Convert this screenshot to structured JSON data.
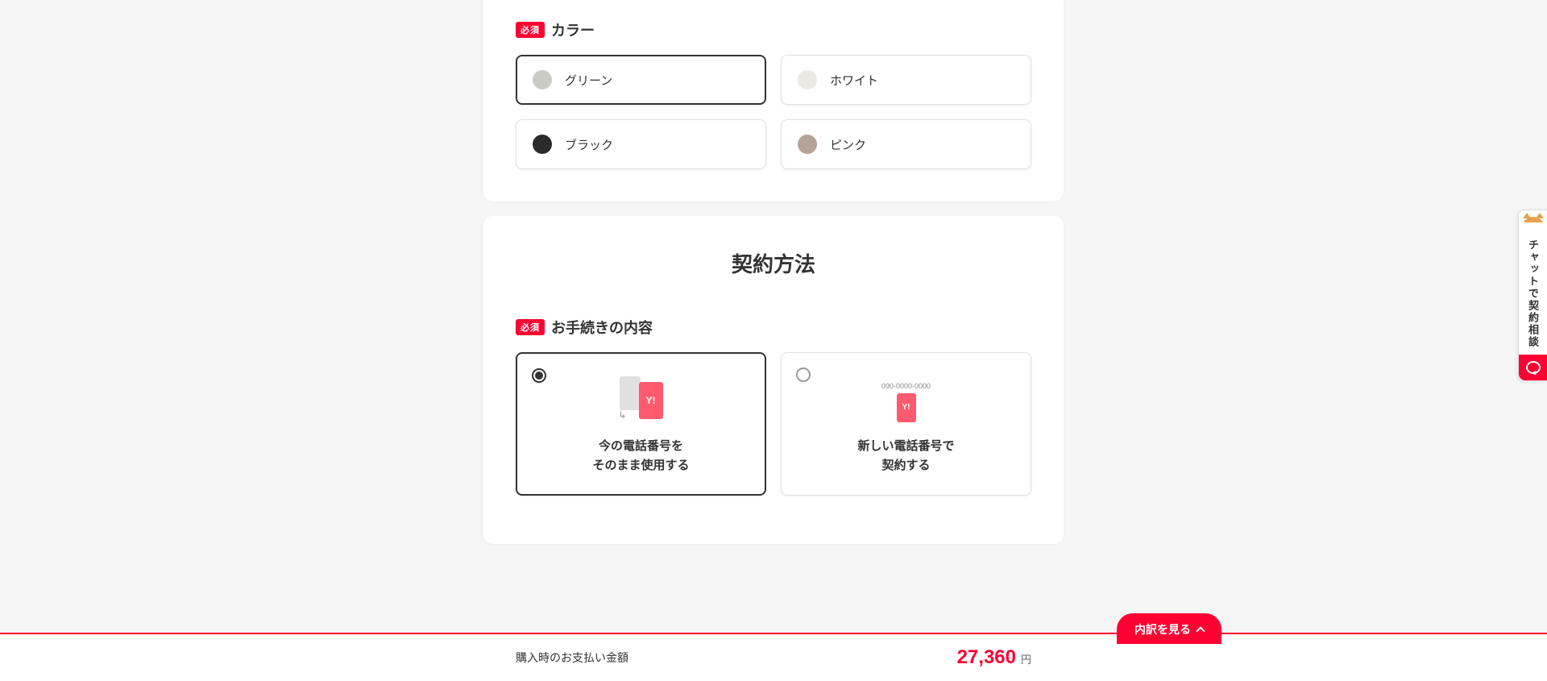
{
  "required_badge": "必須",
  "color_section": {
    "label": "カラー",
    "options": [
      {
        "name": "グリーン",
        "swatch": "#c8ccc5",
        "selected": true
      },
      {
        "name": "ホワイト",
        "swatch": "#ece9e3",
        "selected": false
      },
      {
        "name": "ブラック",
        "swatch": "#2b2b2b",
        "selected": false
      },
      {
        "name": "ピンク",
        "swatch": "#b5a298",
        "selected": false
      }
    ]
  },
  "contract_section": {
    "title": "契約方法",
    "procedure_label": "お手続きの内容",
    "options": [
      {
        "line1": "今の電話番号を",
        "line2": "そのまま使用する",
        "selected": true
      },
      {
        "line1": "新しい電話番号で",
        "line2": "契約する",
        "selected": false,
        "sample_number": "090-0000-0000"
      }
    ]
  },
  "footer": {
    "label": "購入時のお支払い金額",
    "amount": "27,360",
    "unit": "円",
    "breakdown_button": "内訳を見る"
  },
  "chat_tab": {
    "label": "チャットで契約相談"
  },
  "brand_glyph": "Y!"
}
